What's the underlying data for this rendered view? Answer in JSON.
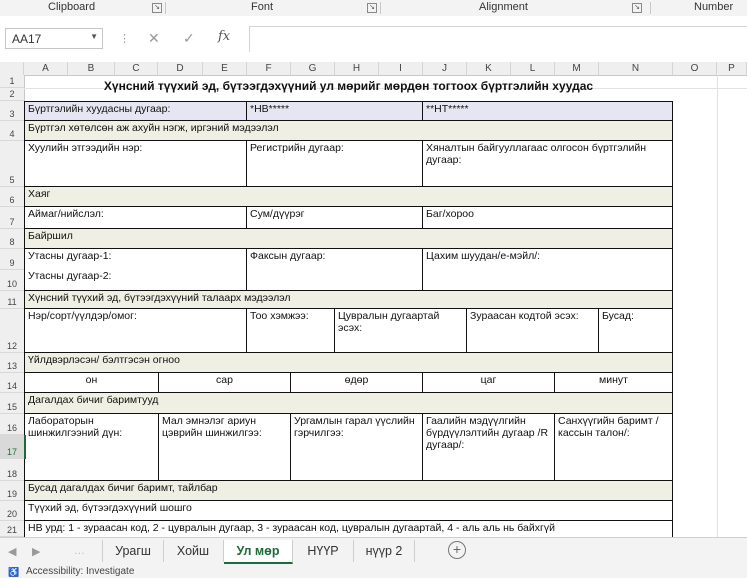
{
  "ribbon": {
    "groups": [
      "Clipboard",
      "Font",
      "Alignment",
      "Number"
    ]
  },
  "formula_bar": {
    "name_box": "AA17",
    "formula": ""
  },
  "columns": [
    "A",
    "B",
    "C",
    "D",
    "E",
    "F",
    "G",
    "H",
    "I",
    "J",
    "K",
    "L",
    "M",
    "N",
    "O",
    "P"
  ],
  "rows": [
    "1",
    "2",
    "3",
    "4",
    "5",
    "6",
    "7",
    "8",
    "9",
    "10",
    "11",
    "12",
    "13",
    "14",
    "15",
    "16",
    "17",
    "18",
    "19",
    "20",
    "21"
  ],
  "form": {
    "title": "Хүнсний түүхий эд, бүтээгдэхүүний ул мөрийг мөрдөн тогтоох бүртгэлийн хуудас",
    "reg_sheet_label": "Бүртгэлийн хуудасны дугаар:",
    "nv": "*НВ*****",
    "nt": "**НТ*****",
    "org_section": "Бүртгэл хөтөлсөн аж ахуйн нэгж, иргэний мэдээлэл",
    "owner_name": "Хуулийн этгээдийн нэр:",
    "reg_number": "Регистрийн дугаар:",
    "permit_number": "Хяналтын байгууллагаас олгосон бүртгэлийн дугаар:",
    "address_section": "Хаяг",
    "aimag": "Аймаг/нийслэл:",
    "sum": "Сум/дүүрэг",
    "bag": "Баг/хороо",
    "location_section": "Байршил",
    "phone1": "Утасны дугаар-1:",
    "phone2": "Утасны дугаар-2:",
    "fax": "Факсын дугаар:",
    "email": "Цахим шуудан/е-мэйл/:",
    "product_section": "Хүнсний түүхий эд, бүтээгдэхүүний талаарх мэдээлэл",
    "product_name": "Нэр/сорт/үүлдэр/омог:",
    "quantity": "Тоо хэмжээ:",
    "batch": "Цувралын дугаартай эсэх:",
    "barcode": "Зураасан кодтой эсэх:",
    "other": "Бусад:",
    "date_section": "Үйлдвэрлэсэн/ бэлтгэсэн огноо",
    "date_parts": [
      "он",
      "сар",
      "өдөр",
      "цаг",
      "минут"
    ],
    "docs_section": "Дагалдах бичиг баримтууд",
    "docs": [
      "Лабораторын шинжилгээний дүн:",
      "Мал эмнэлэг ариун цэврийн шинжилгээ:",
      "Ургамлын гарал үүслийн гэрчилгээ:",
      "Гаалийн мэдүүлгийн бүрдүүлэлтийн дугаар /R дугаар/:",
      "Санхүүгийн баримт /кассын талон/:"
    ],
    "other_docs": "Бусад дагалдах бичиг баримт, тайлбар",
    "route": "Түүхий эд, бүтээгдэхүүний шошго",
    "note": "НВ урд: 1 - зураасан код, 2 - цувралын дугаар, 3 - зураасан код, цувралын дугаартай, 4 - аль аль нь байхгүй"
  },
  "tabs": [
    "Урагш",
    "Хойш",
    "Ул мөр",
    "НҮҮР",
    "нүүр 2"
  ],
  "active_tab": "Ул мөр",
  "status": {
    "accessibility": "Accessibility: Investigate"
  }
}
